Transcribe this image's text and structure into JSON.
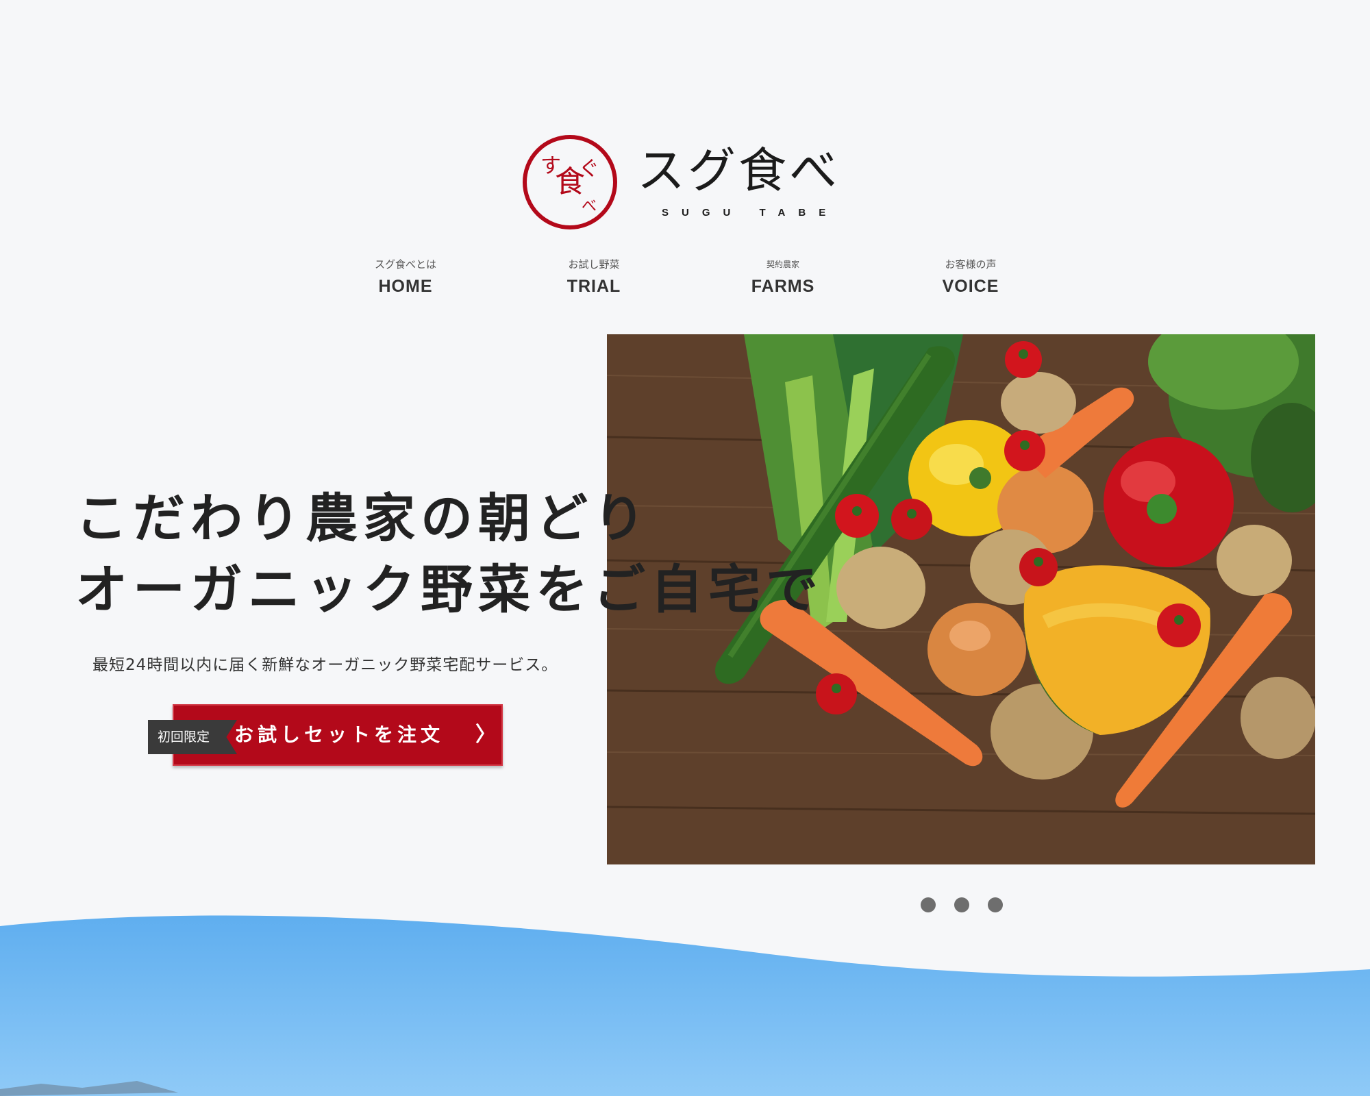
{
  "brand": {
    "logo_mark_text": "すぐ食べ",
    "name": "スグ食べ",
    "romaji": "SUGU TABE",
    "accent_color": "#b3091a"
  },
  "nav": {
    "items": [
      {
        "sub": "スグ食べとは",
        "label": "HOME"
      },
      {
        "sub": "お試し野菜",
        "label": "TRIAL"
      },
      {
        "sub": "契約農家",
        "label": "FARMS"
      },
      {
        "sub": "お客様の声",
        "label": "VOICE"
      }
    ]
  },
  "hero": {
    "headline_line1": "こだわり農家の朝どり",
    "headline_line2": "オーガニック野菜をご自宅で",
    "tagline": "最短24時間以内に届く新鮮なオーガニック野菜宅配サービス。",
    "photo_subject": "vegetables-on-wooden-table",
    "cta": {
      "badge": "初回限定",
      "label": "お試しセットを注文",
      "chevron": "〉"
    }
  },
  "carousel": {
    "slide_count": 3
  }
}
